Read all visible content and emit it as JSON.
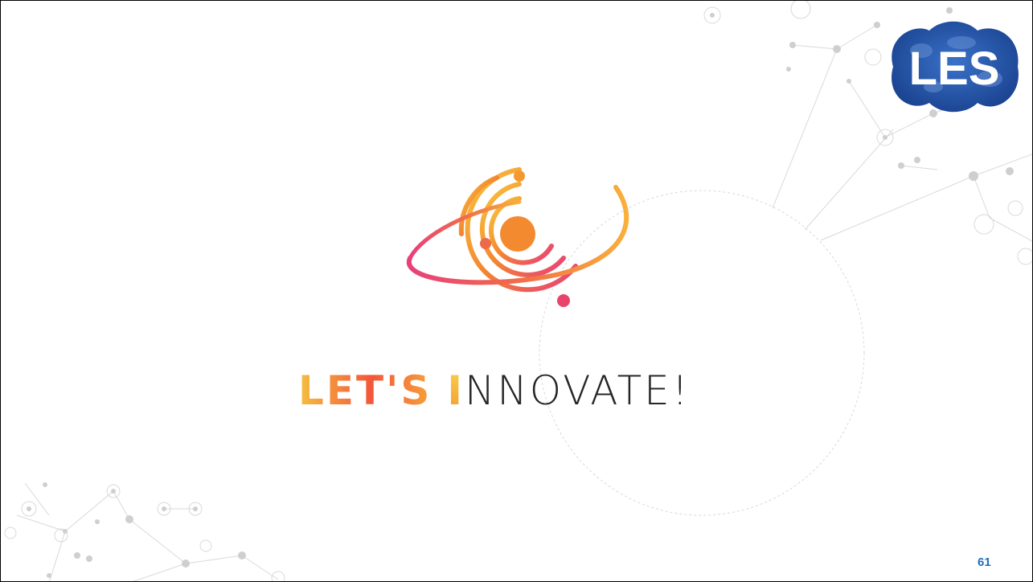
{
  "slide": {
    "tagline_part1": "LET'S",
    "tagline_accent": "I",
    "tagline_part2": "NNOVATE!",
    "badge_text": "LES",
    "page_number": "61"
  },
  "colors": {
    "badge_blue": "#1f4fa8",
    "page_number": "#1f6fb8",
    "gradient_yellow": "#f9c640",
    "gradient_orange": "#f3862f",
    "gradient_pink": "#e8407a"
  },
  "icons": [
    "innovation-orbit-logo-icon",
    "les-globe-icon",
    "network-decoration-icon"
  ]
}
